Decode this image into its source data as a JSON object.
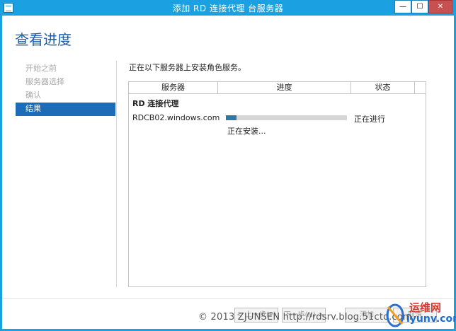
{
  "window": {
    "title": "添加 RD 连接代理 台服务器",
    "min_glyph": "—",
    "max_glyph": "☐",
    "close_glyph": "✕"
  },
  "page": {
    "title": "查看进度"
  },
  "nav": {
    "items": [
      {
        "label": "开始之前",
        "active": false
      },
      {
        "label": "服务器选择",
        "active": false
      },
      {
        "label": "确认",
        "active": false
      },
      {
        "label": "结果",
        "active": true
      }
    ]
  },
  "content": {
    "intro": "正在以下服务器上安装角色服务。",
    "columns": {
      "server": "服务器",
      "progress": "进度",
      "status": "状态"
    },
    "group_label": "RD 连接代理",
    "rows": [
      {
        "server": "RDCB02.windows.com",
        "progress": 0.09,
        "status": "正在进行",
        "substatus": "正在安装..."
      }
    ]
  },
  "footer": {
    "prev": "< 上一步(P)",
    "next": "下一步(N) >",
    "install": "添加",
    "cancel": "取消"
  },
  "watermark": {
    "text": "© 2013 ZJUNSEN http://rdsrv.blog.51cto.com",
    "site": "运维网",
    "domain": "iyunv.com"
  },
  "colors": {
    "titlebar": "#1ba1e2",
    "accent": "#1d6cb8",
    "heading": "#1e5ea8",
    "progress_fill": "#2b79a8"
  }
}
